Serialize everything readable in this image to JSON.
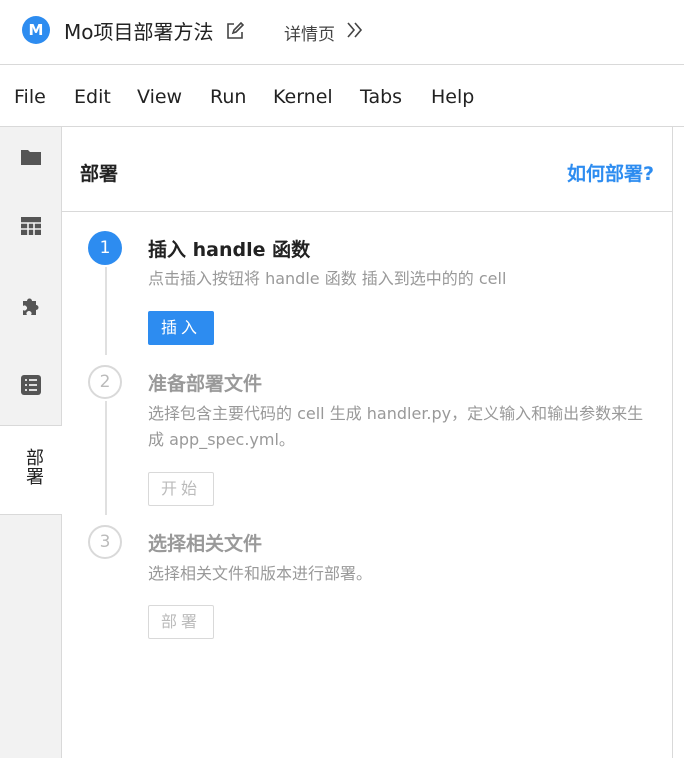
{
  "header": {
    "logo_letter": "M",
    "project_title": "Mo项目部署方法",
    "detail_link": "详情页",
    "accent_color": "#2d8cf0"
  },
  "menu": [
    "File",
    "Edit",
    "View",
    "Run",
    "Kernel",
    "Tabs",
    "Help"
  ],
  "sidebar": {
    "icons": [
      "folder-icon",
      "table-icon",
      "puzzle-icon",
      "list-icon"
    ],
    "active_tab_label": "部署"
  },
  "panel": {
    "title": "部署",
    "help_link": "如何部署?",
    "steps": [
      {
        "number": "1",
        "title": "插入 handle 函数",
        "description": "点击插入按钮将 handle 函数 插入到选中的的 cell",
        "button": "插入",
        "state": "active"
      },
      {
        "number": "2",
        "title": "准备部署文件",
        "description": "选择包含主要代码的 cell 生成 handler.py，定义输入和输出参数来生成 app_spec.yml。",
        "button": "开始",
        "state": "disabled"
      },
      {
        "number": "3",
        "title": "选择相关文件",
        "description": "选择相关文件和版本进行部署。",
        "button": "部署",
        "state": "disabled"
      }
    ]
  }
}
